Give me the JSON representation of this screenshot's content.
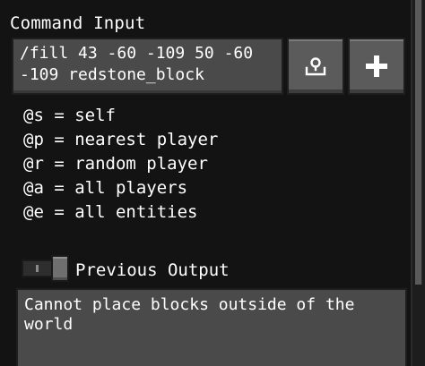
{
  "header": {
    "title": "Command Input"
  },
  "command": {
    "value": "/fill 43 -60 -109 50 -60 -109 redstone_block"
  },
  "buttons": {
    "paste_icon": "paste-icon",
    "add_icon": "plus-icon"
  },
  "selectors": [
    "@s = self",
    "@p = nearest player",
    "@r = random player",
    "@a = all players",
    "@e = all entities"
  ],
  "previous_output": {
    "label": "Previous Output",
    "enabled": false,
    "text": "Cannot place blocks outside of the world"
  },
  "colors": {
    "panel": "#131313",
    "field": "#4a4a4a",
    "button": "#5b5b5b",
    "text": "#ffffff"
  }
}
